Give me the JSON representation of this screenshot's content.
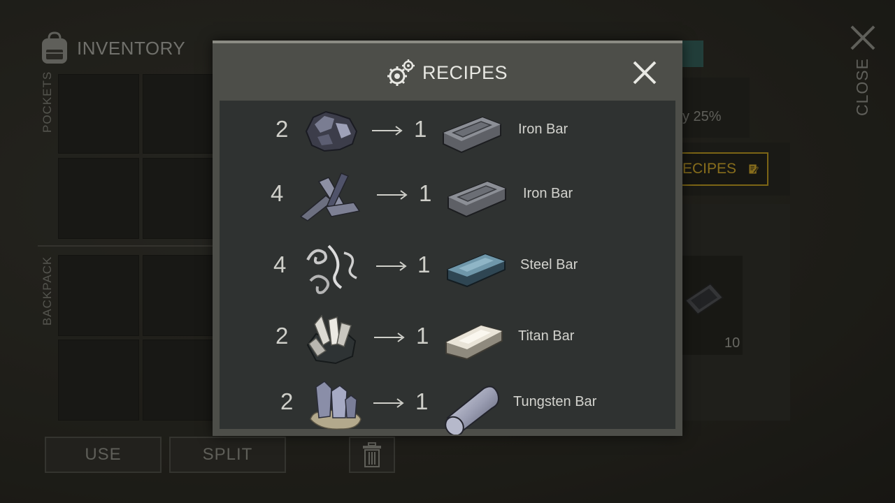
{
  "inventory": {
    "title": "INVENTORY",
    "pockets_label": "POCKETS",
    "backpack_label": "BACKPACK",
    "use_label": "USE",
    "split_label": "SPLIT"
  },
  "background_panel": {
    "percent_text": "y 25%",
    "recipes_button_label": "ECIPES",
    "item_count": "10"
  },
  "close_label": "CLOSE",
  "modal": {
    "title": "RECIPES",
    "recipes": [
      {
        "in_qty": "2",
        "input_icon": "iron-ore-icon",
        "out_qty": "1",
        "output_icon": "iron-bar-icon",
        "name": "Iron Bar"
      },
      {
        "in_qty": "4",
        "input_icon": "scrap-metal-icon",
        "out_qty": "1",
        "output_icon": "iron-bar-icon",
        "name": "Iron Bar"
      },
      {
        "in_qty": "4",
        "input_icon": "metal-shavings-icon",
        "out_qty": "1",
        "output_icon": "steel-bar-icon",
        "name": "Steel Bar"
      },
      {
        "in_qty": "2",
        "input_icon": "titan-ore-icon",
        "out_qty": "1",
        "output_icon": "titan-bar-icon",
        "name": "Titan Bar"
      },
      {
        "in_qty": "2",
        "input_icon": "tungsten-ore-icon",
        "out_qty": "1",
        "output_icon": "tungsten-bar-icon",
        "name": "Tungsten Bar"
      }
    ]
  },
  "colors": {
    "accent_gold": "#c9a227",
    "modal_bg": "#4d4e49",
    "list_bg": "#2f3231",
    "teal_tab": "#2f5a55"
  }
}
